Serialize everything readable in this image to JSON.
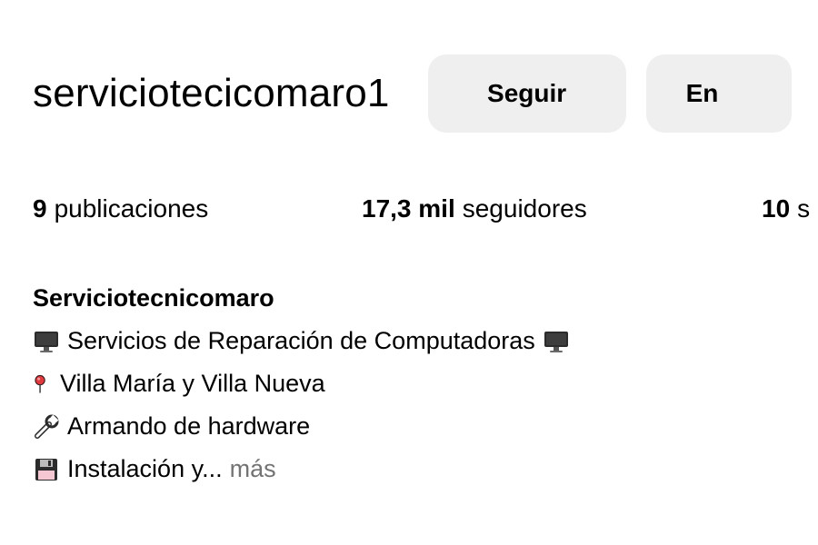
{
  "profile": {
    "username": "serviciotecicomaro1",
    "buttons": {
      "follow_label": "Seguir",
      "message_label": "En"
    },
    "stats": {
      "posts_count": "9",
      "posts_label": "publicaciones",
      "followers_count": "17,3 mil",
      "followers_label": "seguidores",
      "following_count": "10",
      "following_label": "s"
    },
    "bio": {
      "name": "Serviciotecnicomaro",
      "lines": [
        {
          "icon": "computer-icon",
          "text": "Servicios de Reparación de Computadoras",
          "trailing_icon": "computer-icon"
        },
        {
          "icon": "pushpin-icon",
          "text": "Villa María y Villa Nueva"
        },
        {
          "icon": "wrench-icon",
          "text": "Armando de hardware"
        },
        {
          "icon": "floppy-disk-icon",
          "text": "Instalación y...",
          "more_label": "más"
        }
      ]
    }
  },
  "colors": {
    "button_bg": "#efefef",
    "muted_text": "#737373",
    "pin_red": "#e0393e"
  }
}
